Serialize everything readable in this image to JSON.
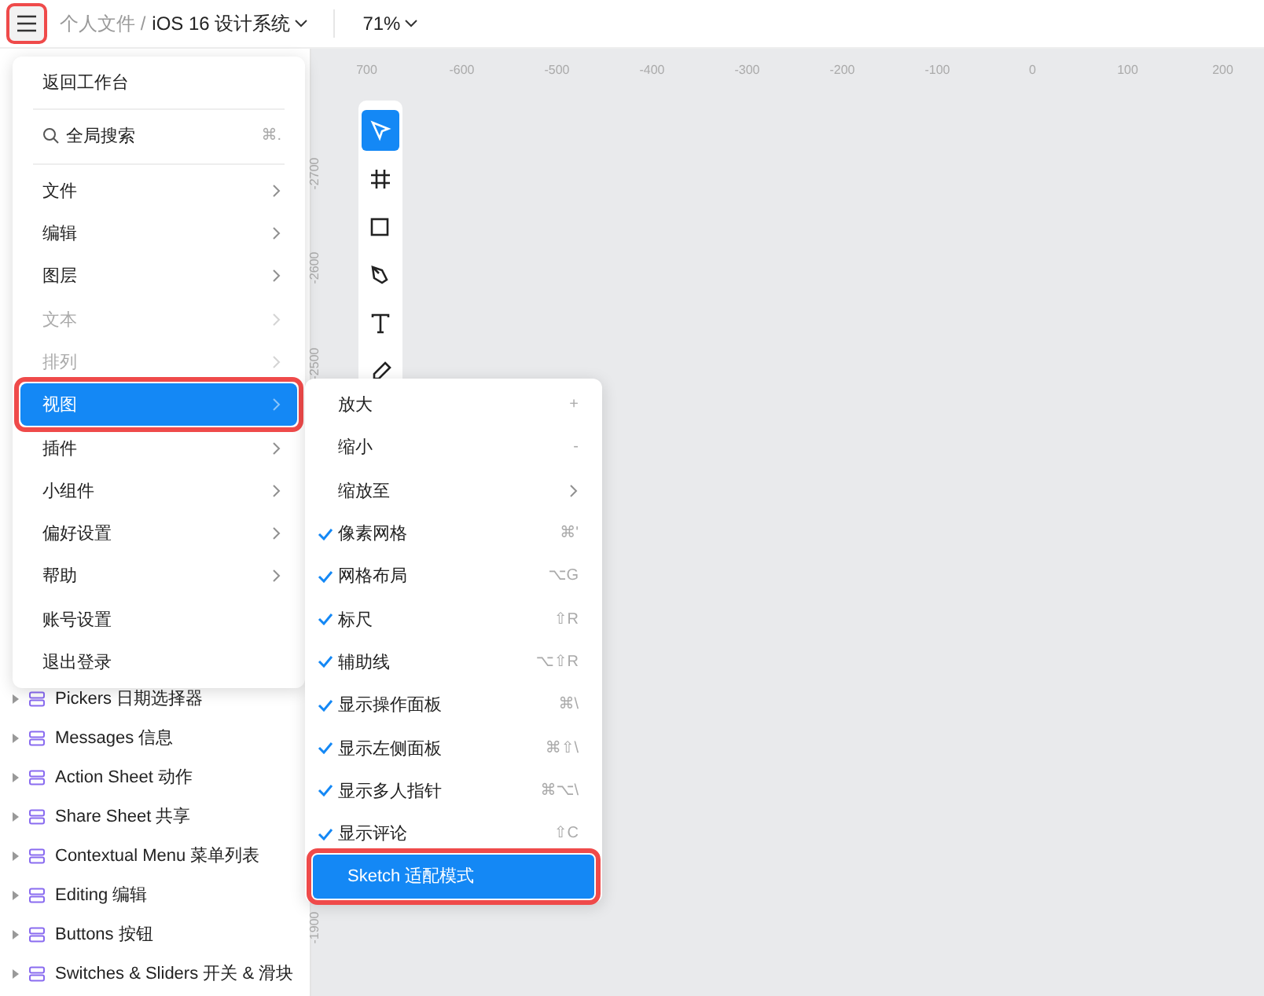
{
  "topbar": {
    "menu_annotated": true,
    "breadcrumb_parent": "个人文件 /",
    "file_name": "iOS 16 设计系统",
    "zoom": "71%"
  },
  "ruler": {
    "x_labels": [
      "700",
      "-600",
      "-500",
      "-400",
      "-300",
      "-200",
      "-100",
      "0",
      "100",
      "200"
    ],
    "y_labels": [
      "-2700",
      "-2600",
      "-2500",
      "-1900"
    ]
  },
  "toolbar": [
    {
      "kind": "select",
      "selected": true
    },
    {
      "kind": "frame",
      "selected": false
    },
    {
      "kind": "rect",
      "selected": false
    },
    {
      "kind": "pen",
      "selected": false
    },
    {
      "kind": "text",
      "selected": false
    },
    {
      "kind": "pencil",
      "selected": false
    }
  ],
  "layers": [
    {
      "label": "Pickers 日期选择器"
    },
    {
      "label": "Messages 信息"
    },
    {
      "label": "Action Sheet 动作"
    },
    {
      "label": "Share Sheet 共享"
    },
    {
      "label": "Contextual Menu 菜单列表"
    },
    {
      "label": "Editing 编辑"
    },
    {
      "label": "Buttons 按钮"
    },
    {
      "label": "Switches & Sliders 开关 & 滑块"
    }
  ],
  "menu": [
    {
      "kind": "action",
      "label": "返回工作台",
      "disabled": false,
      "selected": false
    },
    {
      "kind": "search",
      "label": "全局搜索",
      "shortcut": "⌘.",
      "disabled": false,
      "selected": false
    },
    {
      "kind": "submenu",
      "label": "文件",
      "disabled": false,
      "selected": false
    },
    {
      "kind": "submenu",
      "label": "编辑",
      "disabled": false,
      "selected": false
    },
    {
      "kind": "submenu",
      "label": "图层",
      "disabled": false,
      "selected": false
    },
    {
      "kind": "submenu",
      "label": "文本",
      "disabled": true,
      "selected": false
    },
    {
      "kind": "submenu",
      "label": "排列",
      "disabled": true,
      "selected": false
    },
    {
      "kind": "submenu",
      "label": "视图",
      "disabled": false,
      "selected": true,
      "annotated": true
    },
    {
      "kind": "submenu",
      "label": "插件",
      "disabled": false,
      "selected": false
    },
    {
      "kind": "submenu",
      "label": "小组件",
      "disabled": false,
      "selected": false
    },
    {
      "kind": "submenu",
      "label": "偏好设置",
      "disabled": false,
      "selected": false
    },
    {
      "kind": "submenu",
      "label": "帮助",
      "disabled": false,
      "selected": false
    },
    {
      "kind": "action",
      "label": "账号设置",
      "disabled": false,
      "selected": false
    },
    {
      "kind": "action",
      "label": "退出登录",
      "disabled": false,
      "selected": false
    }
  ],
  "submenu": [
    {
      "label": "放大",
      "shortcut": "+",
      "checked": false,
      "arrow": false,
      "selected": false
    },
    {
      "label": "缩小",
      "shortcut": "-",
      "checked": false,
      "arrow": false,
      "selected": false
    },
    {
      "label": "缩放至",
      "checked": false,
      "arrow": true,
      "selected": false
    },
    {
      "label": "像素网格",
      "shortcut": "⌘'",
      "checked": true,
      "arrow": false,
      "selected": false
    },
    {
      "label": "网格布局",
      "shortcut": "⌥G",
      "checked": true,
      "arrow": false,
      "selected": false
    },
    {
      "label": "标尺",
      "shortcut": "⇧R",
      "checked": true,
      "arrow": false,
      "selected": false
    },
    {
      "label": "辅助线",
      "shortcut": "⌥⇧R",
      "checked": true,
      "arrow": false,
      "selected": false
    },
    {
      "label": "显示操作面板",
      "shortcut": "⌘\\",
      "checked": true,
      "arrow": false,
      "selected": false
    },
    {
      "label": "显示左侧面板",
      "shortcut": "⌘⇧\\",
      "checked": true,
      "arrow": false,
      "selected": false
    },
    {
      "label": "显示多人指针",
      "shortcut": "⌘⌥\\",
      "checked": true,
      "arrow": false,
      "selected": false
    },
    {
      "label": "显示评论",
      "shortcut": "⇧C",
      "checked": true,
      "arrow": false,
      "selected": false
    },
    {
      "label": "Sketch 适配模式",
      "checked": false,
      "arrow": false,
      "selected": true,
      "annotated": true
    }
  ]
}
